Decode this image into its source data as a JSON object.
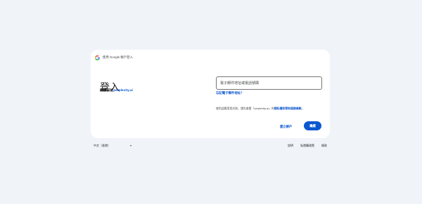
{
  "header": {
    "brand_text": "使用 Google 帳戶登入"
  },
  "main": {
    "title": "登入",
    "subtitle_prefix": "繼續前往",
    "subtitle_link": "perplexity.ai"
  },
  "form": {
    "email_placeholder": "電子郵件地址或電話號碼",
    "email_value": "",
    "forgot_link": "忘記電子郵件地址？",
    "notice_prefix": "使用此應用程式前，請先查看「perplexity.ai」的",
    "notice_link": "隱私權政策和服務條款",
    "notice_suffix": "。"
  },
  "actions": {
    "create_account": "建立帳戶",
    "next": "繼續"
  },
  "footer": {
    "language": "中文（香港）",
    "links": [
      "說明",
      "私隱權政策",
      "條款"
    ]
  },
  "colors": {
    "background": "#f0f4f9",
    "card": "#ffffff",
    "accent": "#0b57d0"
  }
}
